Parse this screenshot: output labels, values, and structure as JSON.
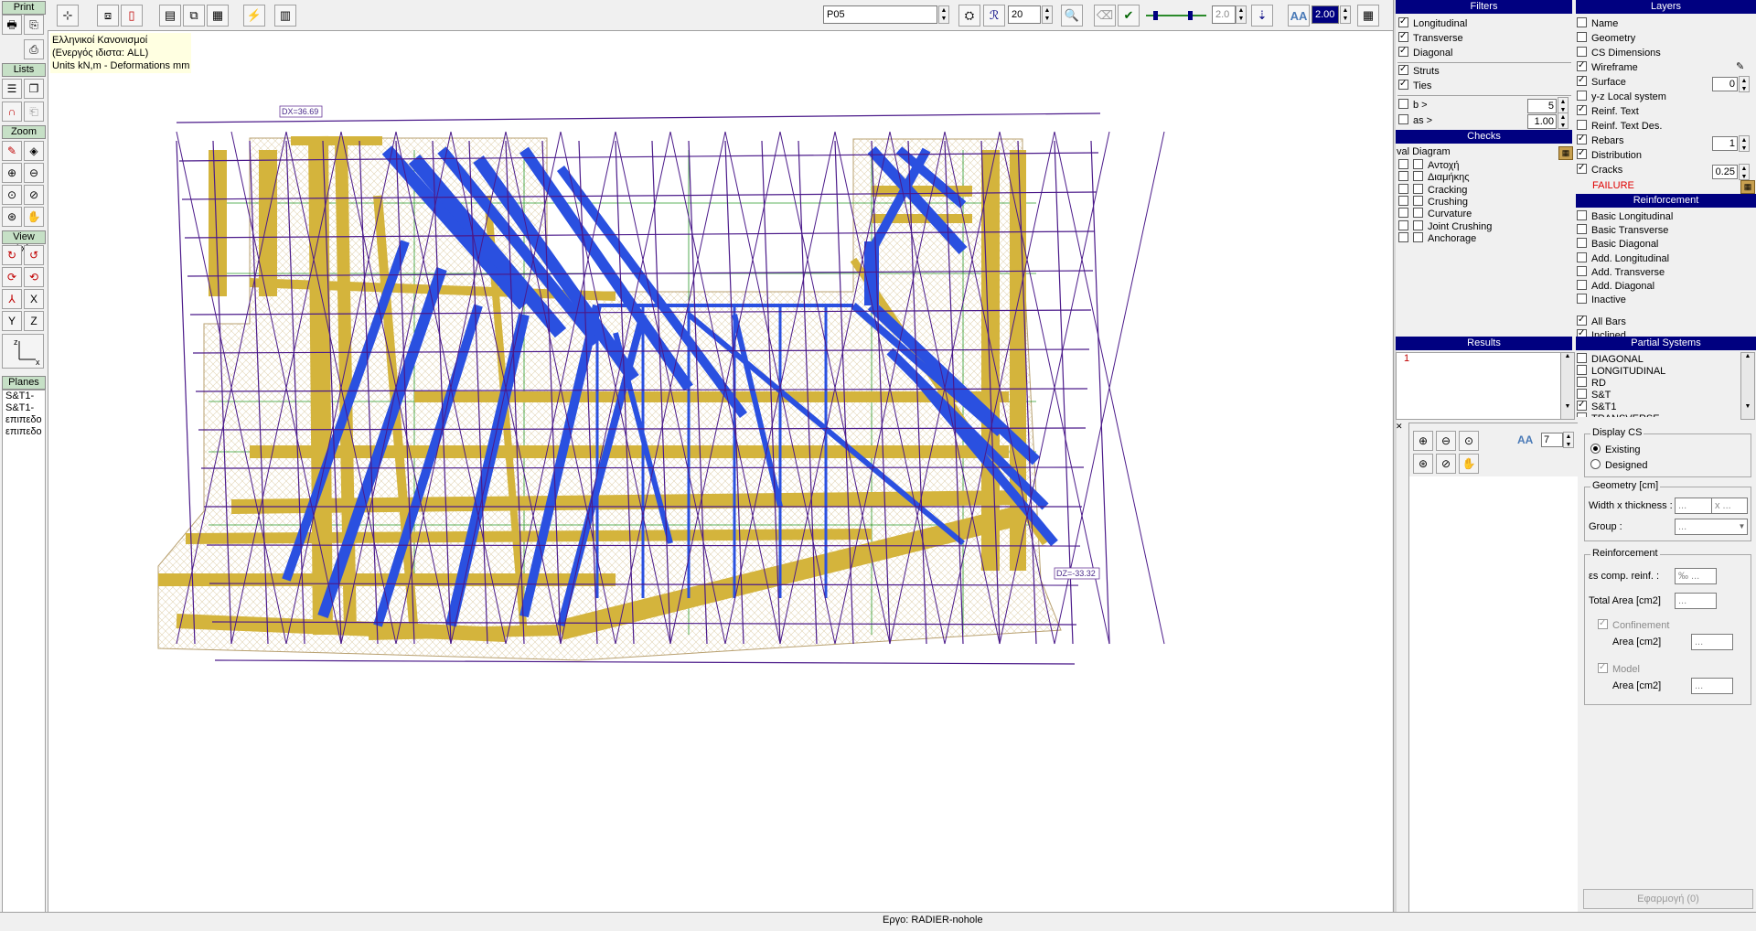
{
  "left_toolbar": {
    "print_title": "Print",
    "lists_title": "Lists",
    "zoom_title": "Zoom",
    "view_axis_title": "View Axis",
    "axis_y": "Y",
    "axis_z": "Z",
    "axis_x": "X",
    "planes_title": "Planes",
    "planes": [
      "S&T1-",
      "S&T1-",
      "επιπεδο",
      "επιπεδο"
    ]
  },
  "top_toolbar": {
    "plan_value": "P05",
    "size_value": "20",
    "scale_value": "2.0",
    "text_scale_value": "2.00"
  },
  "canvas": {
    "info_lines": [
      "Ελληνικοί Κανονισμοί",
      "(Ενεργός ιδιστα: ALL)",
      "Units kN,m - Deformations mm"
    ],
    "dx_label": "DX=36.69",
    "dz_label": "DZ=-33.32"
  },
  "filters": {
    "title": "Filters",
    "items": [
      {
        "label": "Longitudinal",
        "checked": true
      },
      {
        "label": "Transverse",
        "checked": true
      },
      {
        "label": "Diagonal",
        "checked": true
      },
      {
        "label": "Struts",
        "checked": true
      },
      {
        "label": "Ties",
        "checked": true
      }
    ],
    "b_label": "b >",
    "b_value": "5",
    "as_label": "as >",
    "as_value": "1.00"
  },
  "checks": {
    "title": "Checks",
    "diagram_label": "val Diagram",
    "items": [
      "Αντοχή",
      "Διαμήκης",
      "Cracking",
      "Crushing",
      "Curvature",
      "Joint Crushing",
      "Anchorage"
    ]
  },
  "results": {
    "title": "Results",
    "items": [
      "1"
    ]
  },
  "layers": {
    "title": "Layers",
    "items": [
      {
        "label": "Name",
        "checked": false
      },
      {
        "label": "Geometry",
        "checked": false
      },
      {
        "label": "CS Dimensions",
        "checked": false
      },
      {
        "label": "Wireframe",
        "checked": true
      },
      {
        "label": "Surface",
        "checked": true,
        "value": "0"
      },
      {
        "label": "y-z Local system",
        "checked": false
      },
      {
        "label": "Reinf. Text",
        "checked": true
      },
      {
        "label": "Reinf. Text Des.",
        "checked": false
      },
      {
        "label": "Rebars",
        "checked": true,
        "value": "1"
      },
      {
        "label": "Distribution",
        "checked": true
      },
      {
        "label": "Cracks",
        "checked": true,
        "value": "0.25"
      }
    ],
    "failure_label": "FAILURE"
  },
  "reinforcement": {
    "title": "Reinforcement",
    "items": [
      {
        "label": "Basic Longitudinal",
        "checked": false
      },
      {
        "label": "Basic Transverse",
        "checked": false
      },
      {
        "label": "Basic Diagonal",
        "checked": false
      },
      {
        "label": "Add. Longitudinal",
        "checked": false
      },
      {
        "label": "Add. Transverse",
        "checked": false
      },
      {
        "label": "Add. Diagonal",
        "checked": false
      },
      {
        "label": "Inactive",
        "checked": false
      },
      {
        "label": "All Bars",
        "checked": true
      },
      {
        "label": "Inclined",
        "checked": true
      }
    ]
  },
  "partial_systems": {
    "title": "Partial Systems",
    "items": [
      {
        "label": "DIAGONAL",
        "checked": false
      },
      {
        "label": "LONGITUDINAL",
        "checked": false
      },
      {
        "label": "RD",
        "checked": false
      },
      {
        "label": "S&T",
        "checked": false
      },
      {
        "label": "S&T1",
        "checked": true
      },
      {
        "label": "TRANSVERSE",
        "checked": false
      }
    ]
  },
  "properties": {
    "zoom_value": "7",
    "display_cs_title": "Display CS",
    "existing_label": "Existing",
    "designed_label": "Designed",
    "geometry_title": "Geometry [cm]",
    "width_label": "Width x thickness :",
    "width_value": "...",
    "thickness_value": "x ...",
    "group_label": "Group :",
    "group_value": "...",
    "reinf_title": "Reinforcement",
    "es_label": "εs comp. reinf. :",
    "es_value": "‰ ...",
    "total_area_label": "Total Area [cm2]",
    "total_area_value": "...",
    "confinement_label": "Confinement",
    "conf_area_label": "Area [cm2]",
    "conf_area_value": "...",
    "model_label": "Model",
    "model_area_label": "Area [cm2]",
    "model_area_value": "...",
    "apply_button": "Εφαρμογή (0)"
  },
  "status": {
    "project": "Εργο: RADIER-nohole"
  }
}
